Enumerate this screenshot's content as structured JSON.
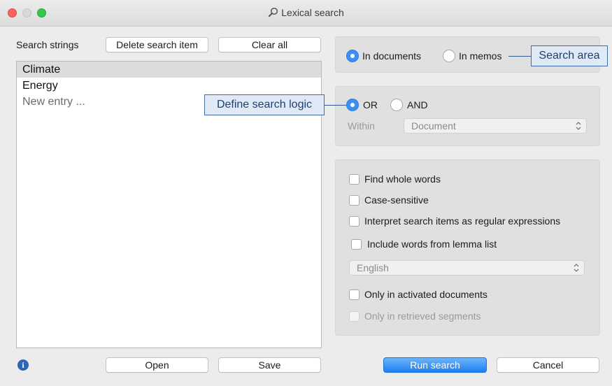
{
  "window": {
    "title": "Lexical search"
  },
  "left": {
    "search_strings_label": "Search strings",
    "delete_button": "Delete search item",
    "clear_button": "Clear all",
    "entries": [
      "Climate",
      "Energy"
    ],
    "new_entry_placeholder": "New entry ...",
    "open_button": "Open",
    "save_button": "Save"
  },
  "search_area": {
    "in_documents": "In documents",
    "in_memos": "In memos",
    "selected": "In documents"
  },
  "logic": {
    "or_label": "OR",
    "and_label": "AND",
    "selected": "OR",
    "within_label": "Within",
    "within_value": "Document"
  },
  "options": {
    "find_whole_words": "Find whole words",
    "case_sensitive": "Case-sensitive",
    "regex": "Interpret search items as regular expressions",
    "lemma": "Include words from lemma list",
    "language_value": "English",
    "activated_docs": "Only in activated documents",
    "retrieved_segments": "Only in retrieved segments"
  },
  "callouts": {
    "search_area": "Search area",
    "search_logic": "Define search logic"
  },
  "footer": {
    "run_button": "Run search",
    "cancel_button": "Cancel",
    "info_glyph": "i"
  },
  "colors": {
    "accent": "#3b8ff2",
    "callout_fill": "#dfeaf6",
    "callout_border": "#3f6ea6"
  }
}
